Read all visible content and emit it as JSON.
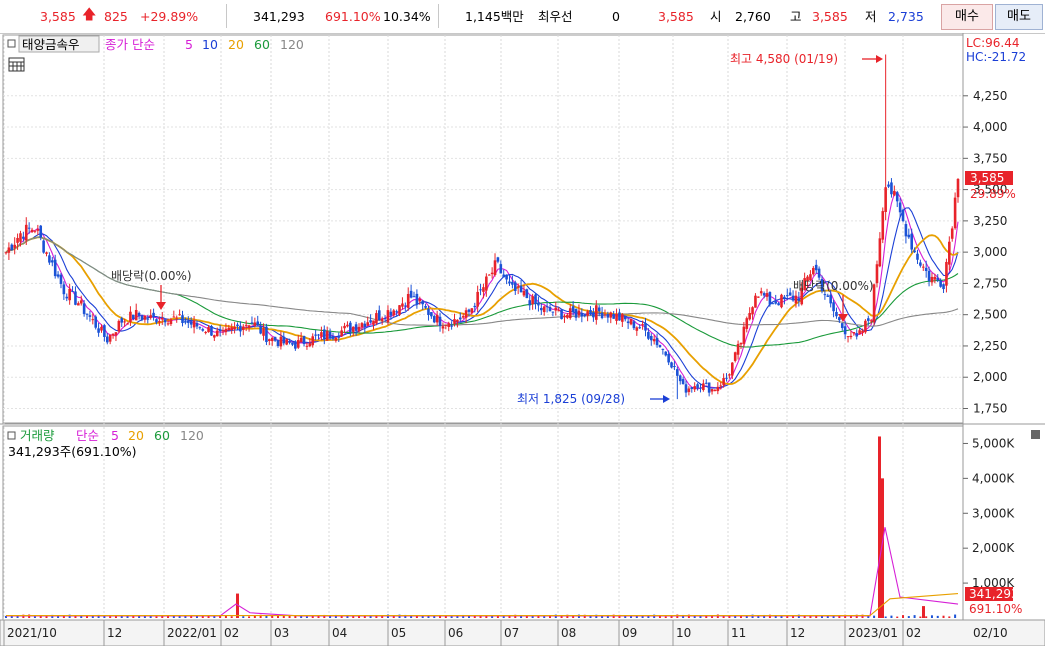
{
  "topbar": {
    "price": "3,585",
    "change": "825",
    "change_pct": "+29.89%",
    "volume": "341,293",
    "vol_ratio": "691.10%",
    "turnover": "10.34%",
    "amount": "1,145백만",
    "priority_label": "최우선",
    "priority_value": "0",
    "priority_price": "3,585",
    "open_label": "시",
    "open": "2,760",
    "high_label": "고",
    "high": "3,585",
    "low_label": "저",
    "low": "2,735",
    "buy_label": "매수",
    "sell_label": "매도"
  },
  "price_panel": {
    "stock_name": "태양금속우",
    "ma_label_prefix": "종가 단순",
    "ma_periods": [
      "5",
      "10",
      "20",
      "60",
      "120"
    ],
    "ma_colors": [
      "#d61fd6",
      "#1b3fd6",
      "#e8a000",
      "#1a9a3a",
      "#888888"
    ],
    "lc_label": "LC:96.44",
    "hc_label": "HC:-21.72",
    "max_annotation": "최고 4,580 (01/19)",
    "min_annotation": "최저 1,825 (09/28)",
    "dividend_label_1": "배당락(0.00%)",
    "dividend_label_2": "배당락(0.00%)",
    "current_price_tag": "3,585",
    "current_pct_tag": "29.89%"
  },
  "volume_panel": {
    "title": "거래량",
    "ma_label_prefix": "단순",
    "ma_periods": [
      "5",
      "20",
      "60",
      "120"
    ],
    "ma_colors": [
      "#d61fd6",
      "#e8a000",
      "#1a9a3a",
      "#888888"
    ],
    "current_volume_text": "341,293주(691.10%)",
    "current_volume_tag": "341,293",
    "current_ratio_tag": "691.10%"
  },
  "x_axis": {
    "labels": [
      "2021/10",
      "12",
      "2022/01",
      "02",
      "03",
      "04",
      "05",
      "06",
      "07",
      "08",
      "09",
      "10",
      "11",
      "12",
      "2023/01",
      "02",
      "02/10"
    ]
  },
  "chart_data": [
    {
      "type": "candlestick",
      "title": "태양금속우",
      "ylim": [
        1650,
        4720
      ],
      "y_ticks": [
        1750,
        2000,
        2250,
        2500,
        2750,
        3000,
        3250,
        3500,
        3750,
        4000,
        4250
      ],
      "y_tick_labels": [
        "1,750",
        "2,000",
        "2,250",
        "2,500",
        "2,750",
        "3,000",
        "3,250",
        "3,500",
        "3,750",
        "4,000",
        "4,250"
      ],
      "close_series": [
        [
          "2021/10",
          3000
        ],
        [
          "2021/10",
          3150
        ],
        [
          "2021/10",
          3200
        ],
        [
          "2021/10",
          2950
        ],
        [
          "2021/11",
          2700
        ],
        [
          "2021/11",
          2600
        ],
        [
          "2021/11",
          2450
        ],
        [
          "2021/11",
          2300
        ],
        [
          "2021/12",
          2450
        ],
        [
          "2021/12",
          2500
        ],
        [
          "2021/12",
          2470
        ],
        [
          "2021/12",
          2480
        ],
        [
          "2022/01",
          2460
        ],
        [
          "2022/01",
          2420
        ],
        [
          "2022/01",
          2380
        ],
        [
          "2022/01",
          2330
        ],
        [
          "2022/02",
          2400
        ],
        [
          "2022/02",
          2450
        ],
        [
          "2022/02",
          2330
        ],
        [
          "2022/02",
          2280
        ],
        [
          "2022/03",
          2260
        ],
        [
          "2022/03",
          2300
        ],
        [
          "2022/03",
          2330
        ],
        [
          "2022/03",
          2360
        ],
        [
          "2022/04",
          2400
        ],
        [
          "2022/04",
          2450
        ],
        [
          "2022/04",
          2500
        ],
        [
          "2022/04",
          2550
        ],
        [
          "2022/05",
          2650
        ],
        [
          "2022/05",
          2550
        ],
        [
          "2022/05",
          2450
        ],
        [
          "2022/05",
          2450
        ],
        [
          "2022/06",
          2500
        ],
        [
          "2022/06",
          2700
        ],
        [
          "2022/06",
          2900
        ],
        [
          "2022/06",
          2700
        ],
        [
          "2022/07",
          2650
        ],
        [
          "2022/07",
          2550
        ],
        [
          "2022/07",
          2520
        ],
        [
          "2022/07",
          2500
        ],
        [
          "2022/08",
          2520
        ],
        [
          "2022/08",
          2530
        ],
        [
          "2022/08",
          2500
        ],
        [
          "2022/08",
          2450
        ],
        [
          "2022/09",
          2400
        ],
        [
          "2022/09",
          2300
        ],
        [
          "2022/09",
          2150
        ],
        [
          "2022/09",
          1900
        ],
        [
          "2022/10",
          1950
        ],
        [
          "2022/10",
          1900
        ],
        [
          "2022/10",
          2000
        ],
        [
          "2022/10",
          2300
        ],
        [
          "2022/11",
          2700
        ],
        [
          "2022/11",
          2600
        ],
        [
          "2022/11",
          2620
        ],
        [
          "2022/11",
          2650
        ],
        [
          "2022/12",
          2900
        ],
        [
          "2022/12",
          2600
        ],
        [
          "2022/12",
          2400
        ],
        [
          "2022/12",
          2300
        ],
        [
          "2023/01",
          2500
        ],
        [
          "2023/01",
          3600
        ],
        [
          "2023/01",
          3300
        ],
        [
          "2023/01",
          3000
        ],
        [
          "2023/02",
          2800
        ],
        [
          "2023/02",
          2760
        ],
        [
          "2023/02",
          3585
        ]
      ],
      "max": {
        "date": "01/19",
        "value": 4580
      },
      "min": {
        "date": "09/28",
        "value": 1825
      }
    },
    {
      "type": "bar",
      "title": "거래량",
      "ylim": [
        0,
        5500
      ],
      "y_ticks": [
        1000,
        2000,
        3000,
        4000,
        5000
      ],
      "y_tick_labels": [
        "1,000K",
        "2,000K",
        "3,000K",
        "4,000K",
        "5,000K"
      ],
      "spikes": [
        {
          "x": "2022/02",
          "value": 700
        },
        {
          "x": "2023/01",
          "value": 5200
        },
        {
          "x": "2023/01",
          "value": 4000
        },
        {
          "x": "2023/02",
          "value": 341
        }
      ]
    }
  ]
}
